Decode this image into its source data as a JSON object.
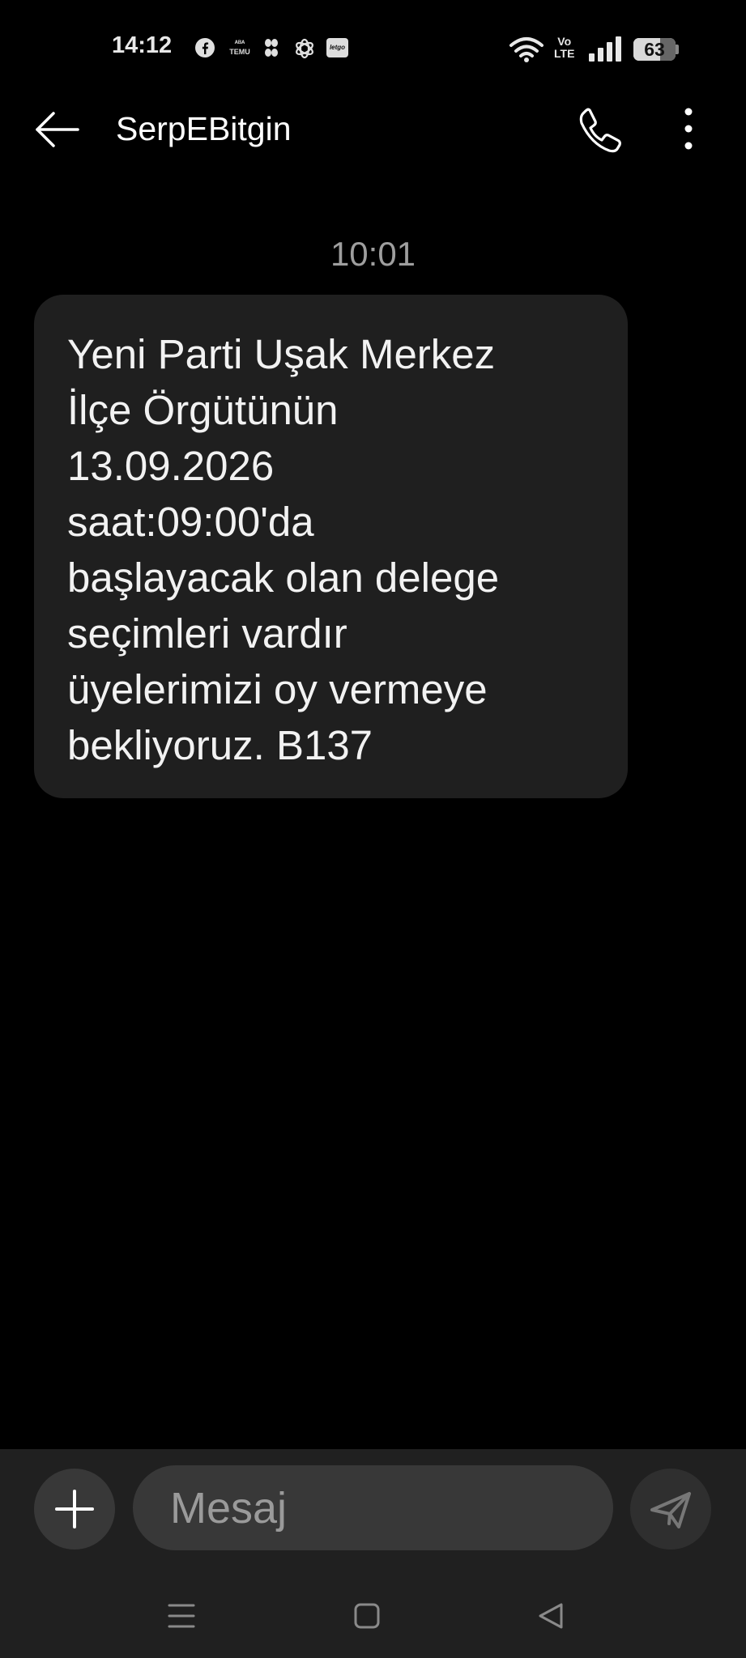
{
  "status_bar": {
    "time": "14:12",
    "notification_icons": [
      "facebook-icon",
      "temu-icon",
      "app-leaf-icon",
      "chatgpt-icon",
      "letgo-icon"
    ],
    "temu_label_top": "ᴬᴮᴬ",
    "temu_label_bottom": "TEMU",
    "letgo_label": "letgo",
    "volte_top": "Vo",
    "volte_bottom": "LTE",
    "battery_level": "63",
    "battery_fraction": 0.63
  },
  "header": {
    "back_icon": "arrow-left-icon",
    "contact_name": "SerpEBitgin",
    "call_icon": "phone-icon",
    "more_icon": "more-vertical-icon"
  },
  "conversation": {
    "timestamp": "10:01",
    "messages": [
      {
        "direction": "incoming",
        "text": "Yeni Parti Uşak Merkez\nİlçe Örgütünün\n13.09.2026\nsaat:09:00'da\nbaşlayacak olan delege\nseçimleri vardır\nüyelerimizi oy vermeye\nbekliyoruz. B137"
      }
    ]
  },
  "composer": {
    "add_icon": "plus-icon",
    "placeholder": "Mesaj",
    "value": "",
    "send_icon": "send-icon"
  },
  "nav_bar": {
    "icons": [
      "menu-icon",
      "home-icon",
      "back-triangle-icon"
    ]
  },
  "colors": {
    "background": "#000000",
    "bubble": "#1f1f1f",
    "composer_bar": "#202020",
    "input_fill": "#383838",
    "muted_text": "#9e9e9e"
  }
}
